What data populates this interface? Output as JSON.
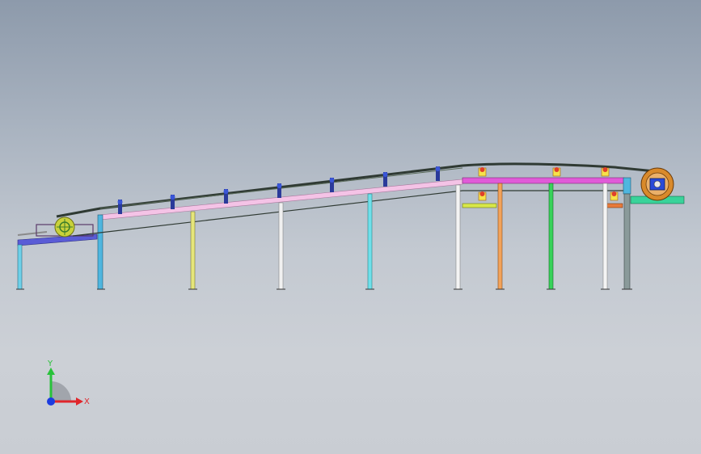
{
  "viewport": {
    "background_top": "#8d9aab",
    "background_bottom": "#c9cdd3"
  },
  "model": {
    "description_visible": false,
    "belt_color": "#2f3a33",
    "supports_count": 11,
    "rollers_incline_count": 7,
    "rollers_flat_count": 3,
    "drive_pulley_color": "#d98a2b",
    "tail_pulley_color": "#c9d13b",
    "incline_beam_color": "#f4c3e6",
    "flat_beam_color": "#e05ad8",
    "tail_frame_color": "#5a5cd6",
    "head_frame_color": "#39d39a"
  },
  "triad": {
    "y_label": "Y",
    "x_label": "X",
    "y_color": "#28c23a",
    "x_color": "#e0262b",
    "z_color": "#1c3ce0"
  }
}
